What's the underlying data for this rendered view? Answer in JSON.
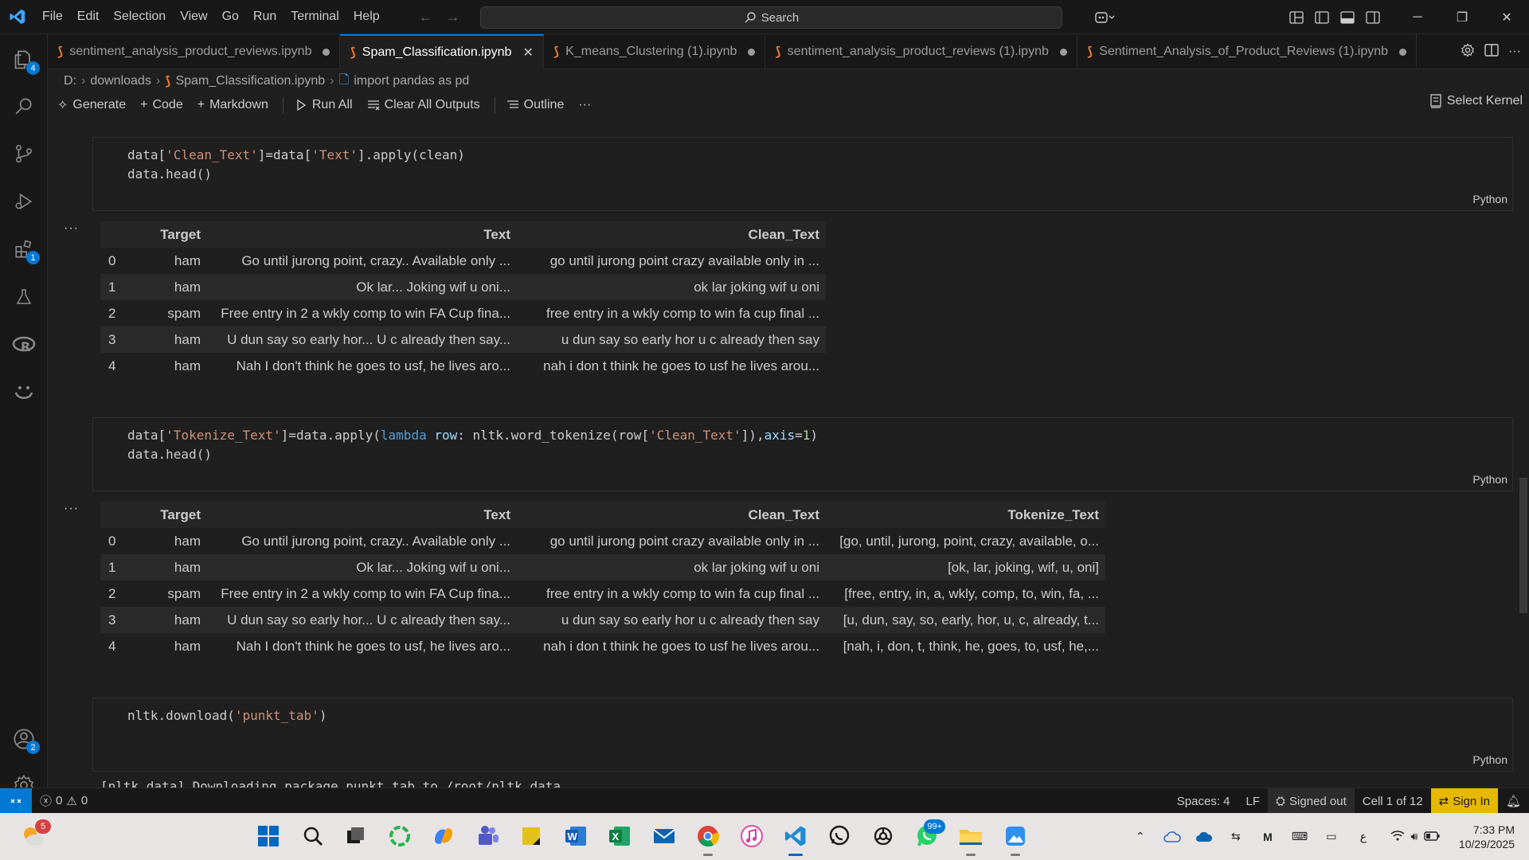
{
  "menu": [
    "File",
    "Edit",
    "Selection",
    "View",
    "Go",
    "Run",
    "Terminal",
    "Help"
  ],
  "search": {
    "label": "Search"
  },
  "tabs": [
    {
      "label": "sentiment_analysis_product_reviews.ipynb",
      "active": false
    },
    {
      "label": "Spam_Classification.ipynb",
      "active": true
    },
    {
      "label": "K_means_Clustering (1).ipynb",
      "active": false
    },
    {
      "label": "sentiment_analysis_product_reviews (1).ipynb",
      "active": false
    },
    {
      "label": "Sentiment_Analysis_of_Product_Reviews (1).ipynb",
      "active": false
    }
  ],
  "breadcrumb": [
    "D:",
    "downloads",
    "Spam_Classification.ipynb",
    "import pandas as pd"
  ],
  "toolbar": {
    "generate": "Generate",
    "code": "Code",
    "markdown": "Markdown",
    "run_all": "Run All",
    "clear_outputs": "Clear All Outputs",
    "outline": "Outline",
    "more": "···",
    "kernel": "Select Kernel"
  },
  "activity_badges": {
    "explorer": "4",
    "extensions": "1",
    "accounts": "2"
  },
  "cells": [
    {
      "lines": [
        "data['Clean_Text']=data['Text'].apply(clean)",
        "data.head()"
      ],
      "lang": "Python"
    },
    {
      "lines": [
        "data['Tokenize_Text']=data.apply(lambda row: nltk.word_tokenize(row['Clean_Text']),axis=1)",
        "data.head()"
      ],
      "lang": "Python"
    },
    {
      "lines": [
        "nltk.download('punkt_tab')"
      ],
      "lang": "Python",
      "output_partial": "[nltk_data] Downloading package punkt_tab to /root/nltk_data..."
    }
  ],
  "table1": {
    "columns": [
      "",
      "Target",
      "Text",
      "Clean_Text"
    ],
    "rows": [
      [
        "0",
        "ham",
        "Go until jurong point, crazy.. Available only ...",
        "go until jurong point crazy available only in ..."
      ],
      [
        "1",
        "ham",
        "Ok lar... Joking wif u oni...",
        "ok lar joking wif u oni"
      ],
      [
        "2",
        "spam",
        "Free entry in 2 a wkly comp to win FA Cup fina...",
        "free entry in a wkly comp to win fa cup final ..."
      ],
      [
        "3",
        "ham",
        "U dun say so early hor... U c already then say...",
        "u dun say so early hor u c already then say"
      ],
      [
        "4",
        "ham",
        "Nah I don't think he goes to usf, he lives aro...",
        "nah i don t think he goes to usf he lives arou..."
      ]
    ]
  },
  "table2": {
    "columns": [
      "",
      "Target",
      "Text",
      "Clean_Text",
      "Tokenize_Text"
    ],
    "rows": [
      [
        "0",
        "ham",
        "Go until jurong point, crazy.. Available only ...",
        "go until jurong point crazy available only in ...",
        "[go, until, jurong, point, crazy, available, o..."
      ],
      [
        "1",
        "ham",
        "Ok lar... Joking wif u oni...",
        "ok lar joking wif u oni",
        "[ok, lar, joking, wif, u, oni]"
      ],
      [
        "2",
        "spam",
        "Free entry in 2 a wkly comp to win FA Cup fina...",
        "free entry in a wkly comp to win fa cup final ...",
        "[free, entry, in, a, wkly, comp, to, win, fa, ..."
      ],
      [
        "3",
        "ham",
        "U dun say so early hor... U c already then say...",
        "u dun say so early hor u c already then say",
        "[u, dun, say, so, early, hor, u, c, already, t..."
      ],
      [
        "4",
        "ham",
        "Nah I don't think he goes to usf, he lives aro...",
        "nah i don t think he goes to usf he lives arou...",
        "[nah, i, don, t, think, he, goes, to, usf, he,..."
      ]
    ]
  },
  "status": {
    "errors": "0",
    "warnings": "0",
    "spaces": "Spaces: 4",
    "eol": "LF",
    "signed_out": "Signed out",
    "cell": "Cell 1 of 12",
    "sign_in": "Sign In"
  },
  "taskbar": {
    "weather_badge": "5",
    "whatsapp_badge": "99+",
    "time": "7:33 PM",
    "date": "10/29/2025",
    "lang": "ع"
  },
  "colors": {
    "accent": "#0078d4",
    "string": "#ce9178",
    "keyword": "#569cd6",
    "signin": "#e6b800"
  }
}
